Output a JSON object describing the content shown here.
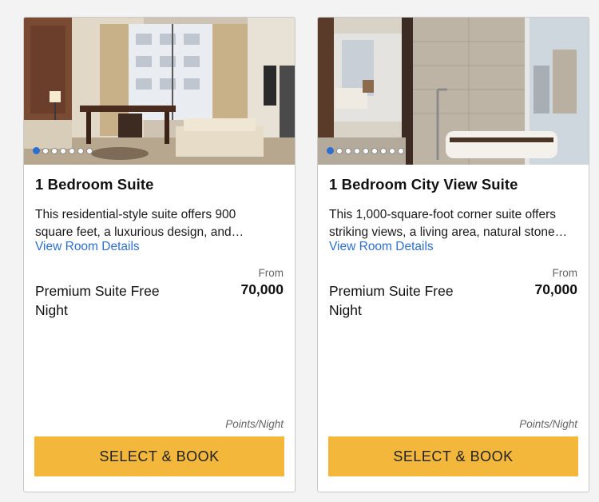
{
  "rooms": [
    {
      "title": "1 Bedroom Suite",
      "description": "This residential-style suite offers 900 square feet, a luxurious design, and…",
      "details_link": "View Room Details",
      "rate_name": "Premium Suite Free Night",
      "from_label": "From",
      "points": "70,000",
      "unit_label": "Points/Night",
      "book_label": "SELECT & BOOK",
      "photo": "living-room-photo",
      "carousel": {
        "total": 7,
        "active": 1
      }
    },
    {
      "title": "1 Bedroom City View Suite",
      "description": "This 1,000-square-foot corner suite offers striking views, a living area, natural stone…",
      "details_link": "View Room Details",
      "rate_name": "Premium Suite Free Night",
      "from_label": "From",
      "points": "70,000",
      "unit_label": "Points/Night",
      "book_label": "SELECT & BOOK",
      "photo": "bathroom-city-view-photo",
      "carousel": {
        "total": 9,
        "active": 1
      }
    }
  ],
  "colors": {
    "accent_button": "#f3b73c",
    "link": "#2d6fd1",
    "active_dot": "#2d6fd1"
  }
}
